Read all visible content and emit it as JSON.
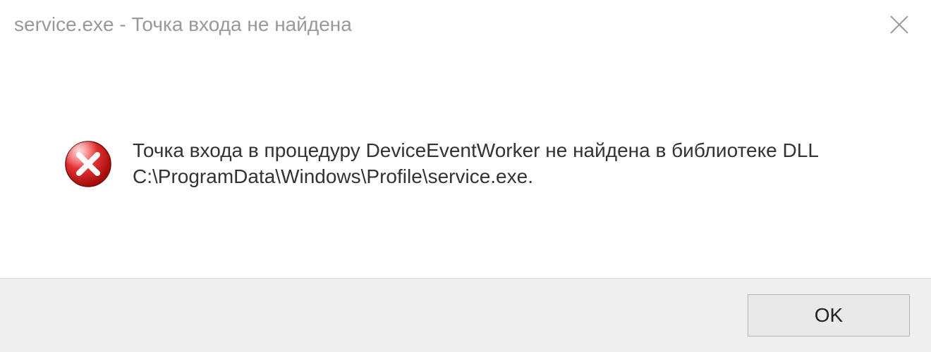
{
  "titlebar": {
    "title": "service.exe - Точка входа не найдена"
  },
  "message": {
    "text": "Точка входа в процедуру DeviceEventWorker не найдена в библиотеке DLL C:\\ProgramData\\Windows\\Profile\\service.exe."
  },
  "footer": {
    "ok_label": "OK"
  }
}
